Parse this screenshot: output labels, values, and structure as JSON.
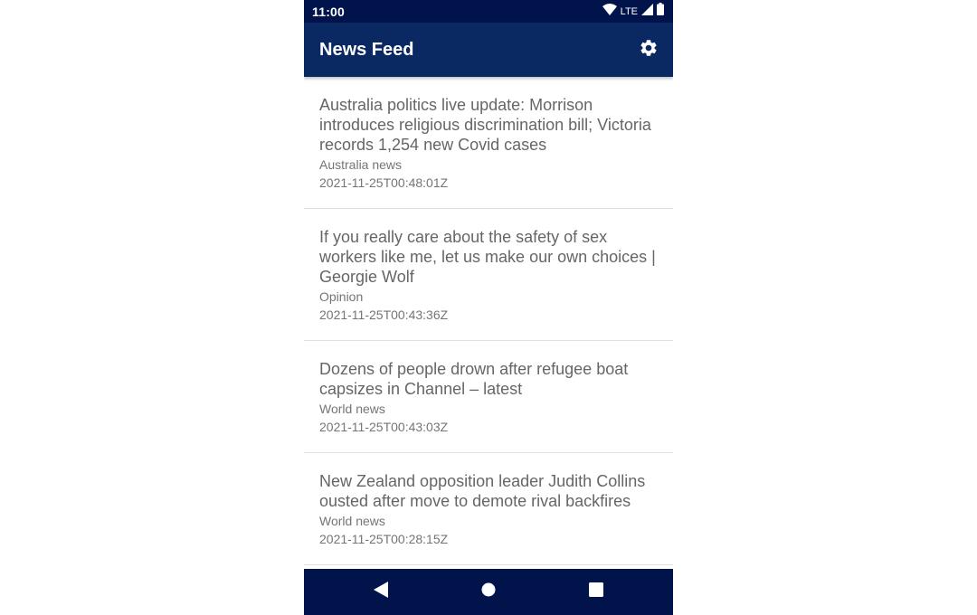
{
  "status_bar": {
    "time": "11:00",
    "network": "LTE",
    "icons": [
      "wifi-icon",
      "signal-icon",
      "battery-icon"
    ]
  },
  "app_bar": {
    "title": "News Feed",
    "settings_icon": "gear-icon"
  },
  "feed": {
    "items": [
      {
        "title": "Australia politics live update: Morrison introduces religious discrimination bill; Victoria records 1,254 new Covid cases",
        "section": "Australia news",
        "date": "2021-11-25T00:48:01Z"
      },
      {
        "title": "If you really care about the safety of sex workers like me, let us make our own choices | Georgie Wolf",
        "section": "Opinion",
        "date": "2021-11-25T00:43:36Z"
      },
      {
        "title": "Dozens of people drown after refugee boat capsizes in Channel – latest",
        "section": "World news",
        "date": "2021-11-25T00:43:03Z"
      },
      {
        "title": "New Zealand opposition leader Judith Collins ousted after move to demote rival backfires",
        "section": "World news",
        "date": "2021-11-25T00:28:15Z"
      }
    ]
  },
  "nav_bar": {
    "buttons": [
      "back-icon",
      "home-icon",
      "recents-icon"
    ]
  },
  "colors": {
    "status_bar": "#00134a",
    "app_bar": "#0a2962",
    "nav_bar": "#00134a",
    "text_primary": "#666666",
    "text_secondary": "#757575",
    "divider": "#e0e0e0"
  }
}
